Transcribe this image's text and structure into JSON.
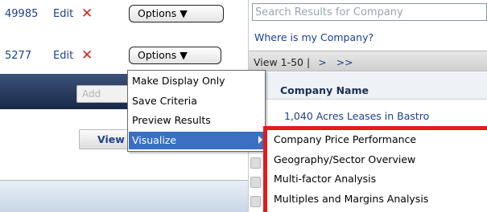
{
  "criteria_rows": [
    {
      "id": "49985",
      "edit_label": "Edit",
      "delete_glyph": "✕",
      "options_label": "Options ▼"
    },
    {
      "id": "5277",
      "edit_label": "Edit",
      "delete_glyph": "✕",
      "options_label": "Options ▼"
    }
  ],
  "left_panel": {
    "add_button_label": "Add",
    "view_button_label": "View"
  },
  "context_menu": {
    "items": [
      {
        "label": "Make Display Only"
      },
      {
        "label": "Save Criteria"
      },
      {
        "label": "Preview Results"
      },
      {
        "label": "Visualize",
        "has_submenu": true
      }
    ]
  },
  "visualize_submenu": {
    "items": [
      "Company Price Performance",
      "Geography/Sector Overview",
      "Multi-factor Analysis",
      "Multiples and Margins Analysis"
    ]
  },
  "search_panel": {
    "search_placeholder": "Search Results for Company",
    "help_link": "Where is my Company?",
    "results_range": "View 1-50 |",
    "next_glyph": ">",
    "last_glyph": ">>",
    "column_header": "Company Name",
    "first_result": "1,040 Acres Leases in Bastro"
  },
  "colors": {
    "link_blue": "#1d3f8e",
    "delete_red": "#d8231f",
    "highlight_blue": "#3a6fc4",
    "annotation_red": "#e21b1b"
  },
  "icons": {
    "delete": "close-x-icon",
    "dropdown": "triangle-down-icon",
    "submenu": "chevron-right-icon",
    "row": "row-toggle-icon"
  }
}
